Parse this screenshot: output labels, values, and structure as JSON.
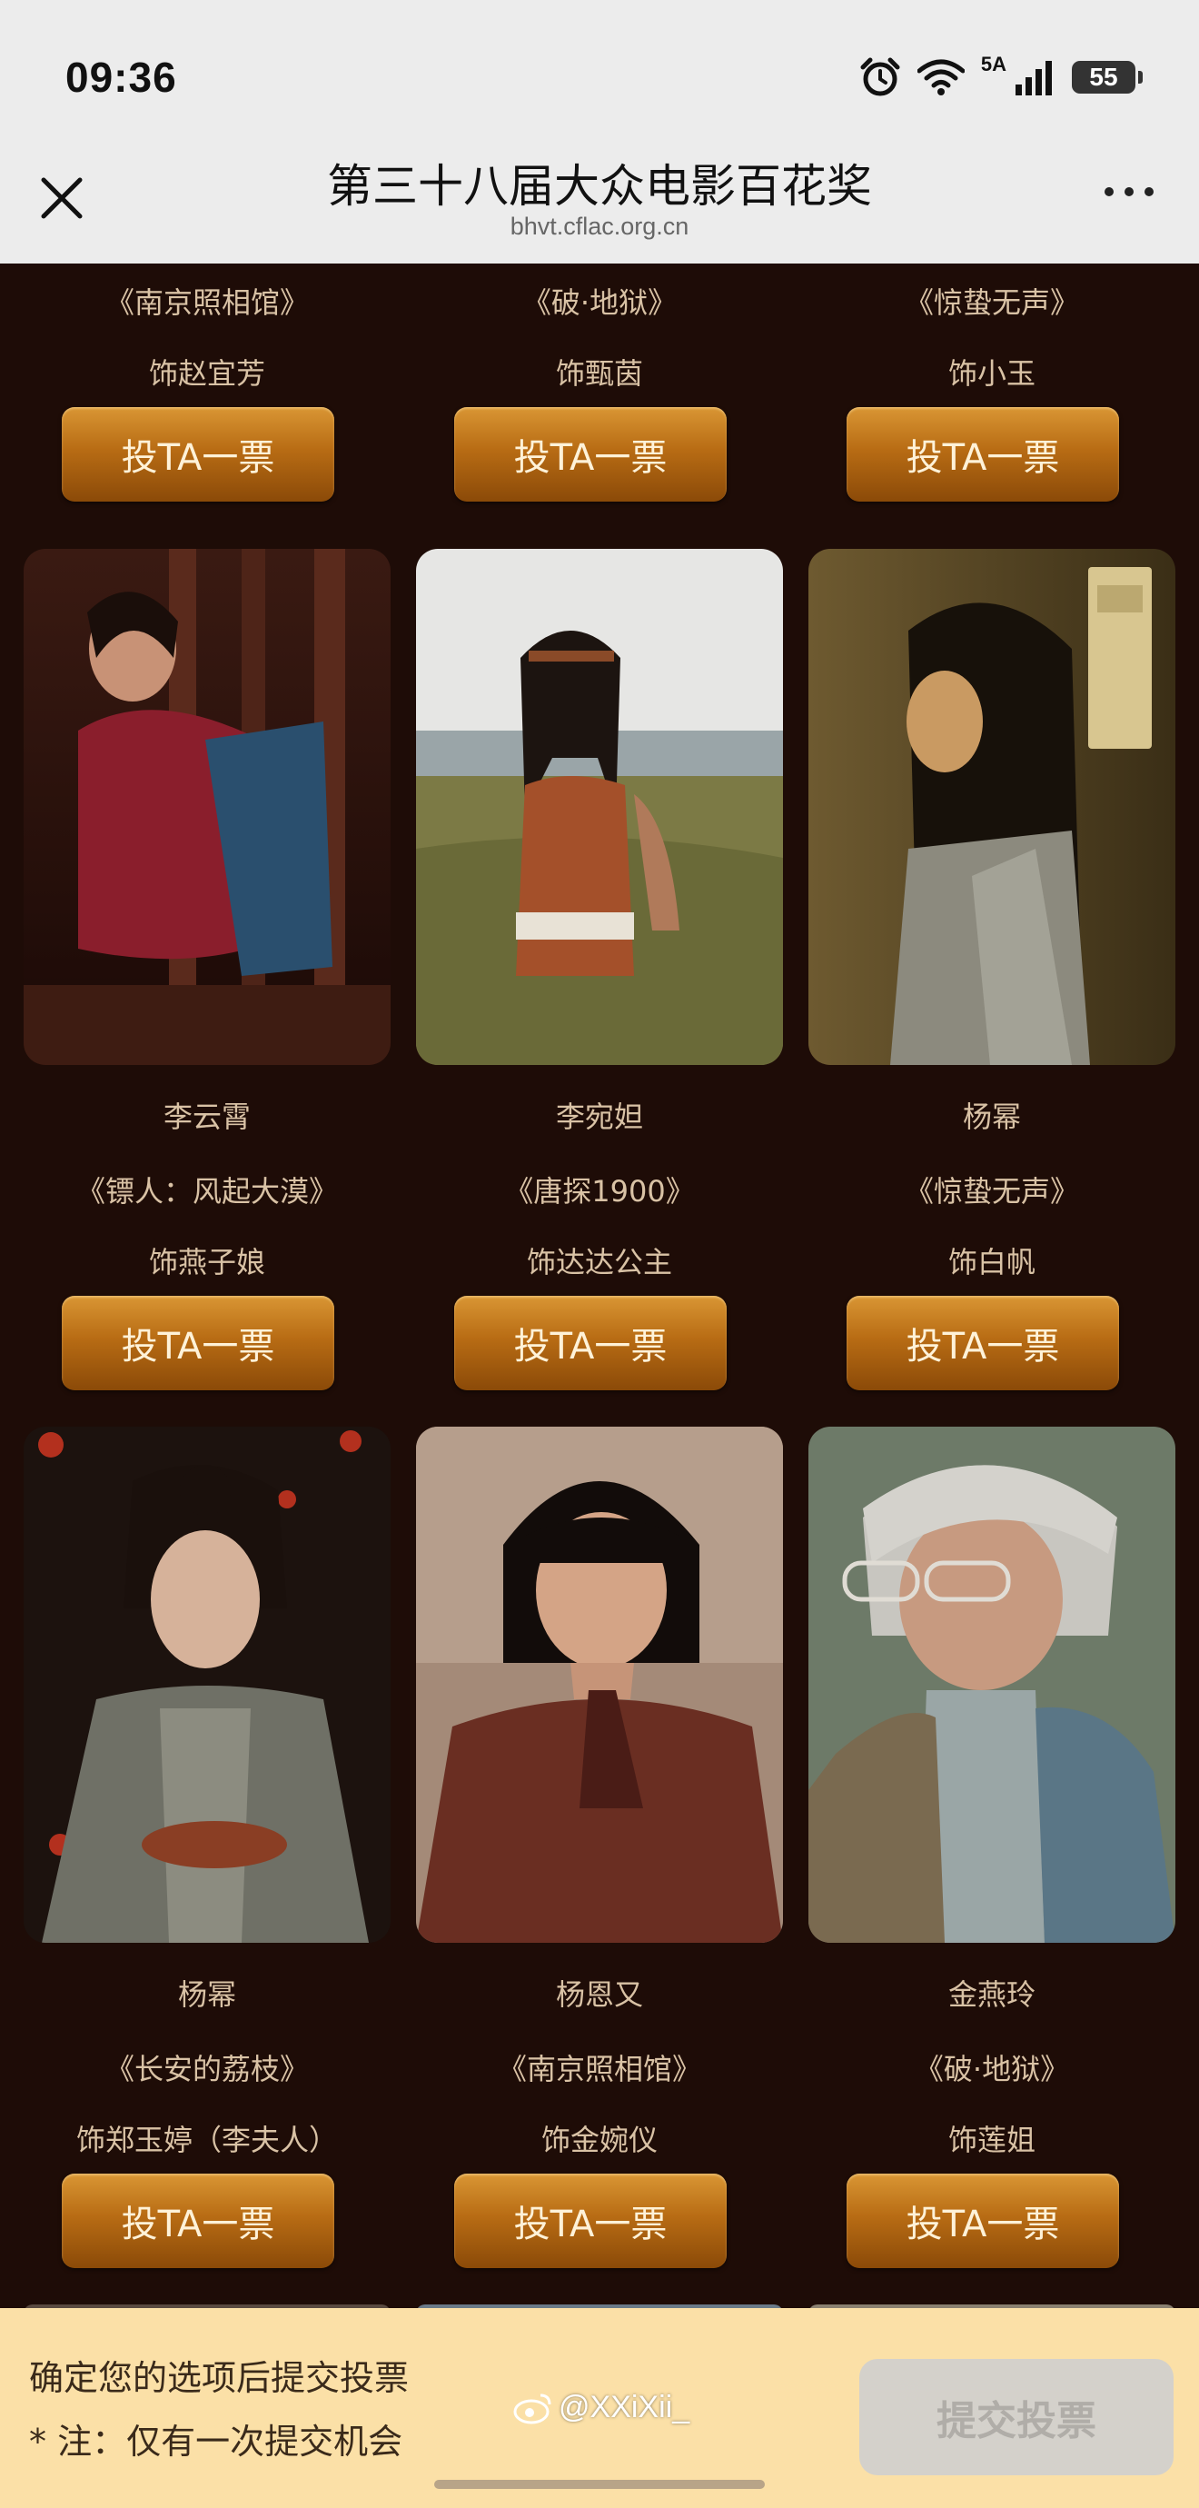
{
  "status_bar": {
    "time": "09:36",
    "network": "5A",
    "battery": "55",
    "icons": [
      "alarm-icon",
      "wifi-icon",
      "signal-icon",
      "battery-icon"
    ]
  },
  "nav": {
    "title": "第三十八届大众电影百花奖",
    "url": "bhvt.cflac.org.cn",
    "close_icon": "close-icon",
    "more_icon": "more-icon"
  },
  "candidates": [
    {
      "film": "《南京照相馆》",
      "role": "饰赵宜芳",
      "vote_label": "投TA一票"
    },
    {
      "film": "《破·地狱》",
      "role": "饰甄茵",
      "vote_label": "投TA一票"
    },
    {
      "film": "《惊蛰无声》",
      "role": "饰小玉",
      "vote_label": "投TA一票"
    },
    {
      "name": "李云霄",
      "film": "《镖人：风起大漠》",
      "role": "饰燕子娘",
      "vote_label": "投TA一票"
    },
    {
      "name": "李宛妲",
      "film": "《唐探1900》",
      "role": "饰达达公主",
      "vote_label": "投TA一票"
    },
    {
      "name": "杨幂",
      "film": "《惊蛰无声》",
      "role": "饰白帆",
      "vote_label": "投TA一票"
    },
    {
      "name": "杨幂",
      "film": "《长安的荔枝》",
      "role": "饰郑玉婷（李夫人）",
      "vote_label": "投TA一票"
    },
    {
      "name": "杨恩又",
      "film": "《南京照相馆》",
      "role": "饰金婉仪",
      "vote_label": "投TA一票"
    },
    {
      "name": "金燕玲",
      "film": "《破·地狱》",
      "role": "饰莲姐",
      "vote_label": "投TA一票"
    }
  ],
  "bottom_bar": {
    "confirm_text": "确定您的选项后提交投票",
    "note_text": "* 注：仅有一次提交机会",
    "submit_label": "提交投票"
  },
  "watermark": "@XXiXii_",
  "colors": {
    "page_background": "#1e0c07",
    "text": "#d9c2a5",
    "button_top": "#d99634",
    "button_bottom": "#8b4a08",
    "bottom_bar": "#fbe0a7",
    "submit_disabled": "#d4d1cb"
  }
}
